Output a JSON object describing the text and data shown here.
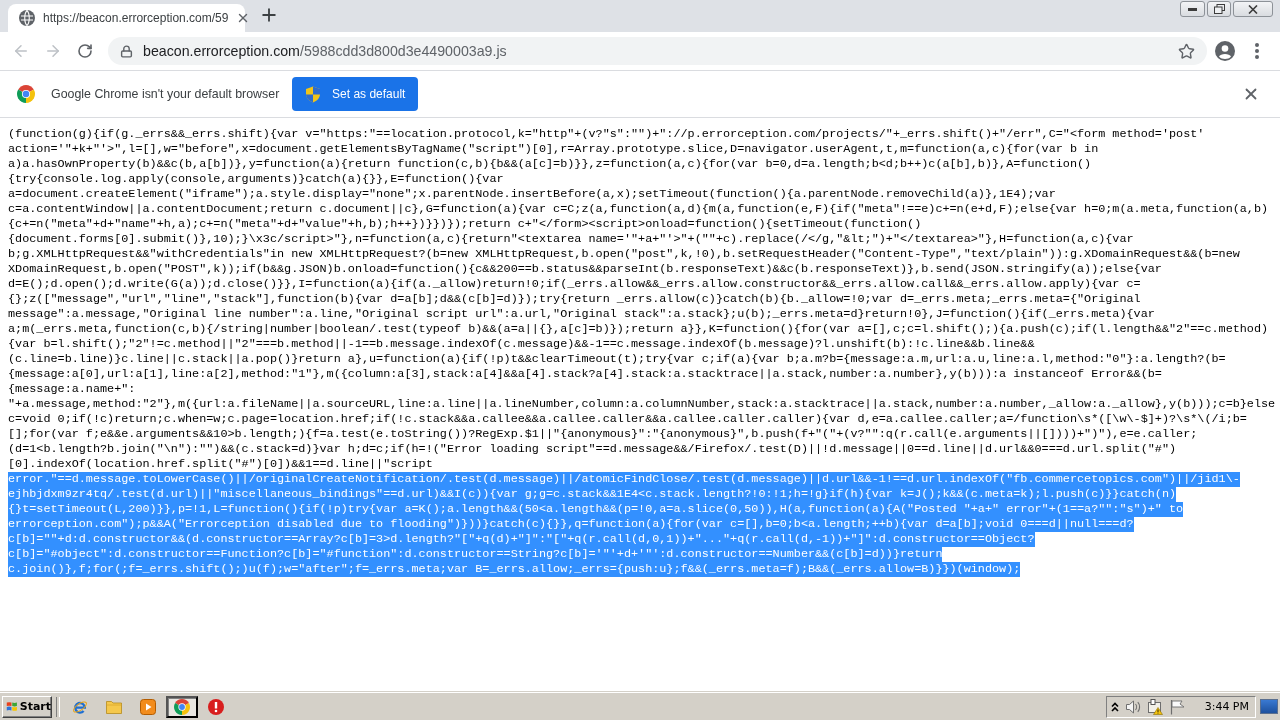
{
  "browser": {
    "tabs": [
      {
        "title": "https://beacon.errorception.com/59",
        "selected": true
      }
    ],
    "nav_buttons": [
      {
        "kind": "back",
        "disabled": true
      },
      {
        "kind": "forward",
        "disabled": true
      },
      {
        "kind": "reload",
        "disabled": false
      }
    ],
    "address_bar": {
      "domain": "beacon.errorception.com",
      "path": "/5988cdd3d800d3e4490003a9.js"
    }
  },
  "infobar": {
    "message": "Google Chrome isn't your default browser",
    "button": "Set as default"
  },
  "page": {
    "code_lines": [
      {
        "text": "(function(g){if(g._errs&&_errs.shift){var v=\"https:\"==location.protocol,k=\"http\"+(v?\"s\":\"\")+\"://p.errorception.com/projects/\"+_errs.shift()+\"/err\",C=\"<form method='post'",
        "selected": false
      },
      {
        "text": "action='\"+k+\"'>\",l=[],w=\"before\",x=document.getElementsByTagName(\"script\")[0],r=Array.prototype.slice,D=navigator.userAgent,t,m=function(a,c){for(var b in",
        "selected": false
      },
      {
        "text": "a)a.hasOwnProperty(b)&&c(b,a[b])},y=function(a){return function(c,b){b&&(a[c]=b)}},z=function(a,c){for(var b=0,d=a.length;b<d;b++)c(a[b],b)},A=function()",
        "selected": false
      },
      {
        "text": "{try{console.log.apply(console,arguments)}catch(a){}},E=function(){var",
        "selected": false
      },
      {
        "text": "a=document.createElement(\"iframe\");a.style.display=\"none\";x.parentNode.insertBefore(a,x);setTimeout(function(){a.parentNode.removeChild(a)},1E4);var",
        "selected": false
      },
      {
        "text": "c=a.contentWindow||a.contentDocument;return c.document||c},G=function(a){var c=C;z(a,function(a,d){m(a,function(e,F){if(\"meta\"!==e)c+=n(e+d,F);else{var h=0;m(a.meta,function(a,b)",
        "selected": false
      },
      {
        "text": "{c+=n(\"meta\"+d+\"name\"+h,a);c+=n(\"meta\"+d+\"value\"+h,b);h++})}})});return c+\"</form><script>onload=function(){setTimeout(function()",
        "selected": false
      },
      {
        "text": "{document.forms[0].submit()},10);}\\x3c/script>\"},n=function(a,c){return\"<textarea name='\"+a+\"'>\"+(\"\"+c).replace(/</g,\"&lt;\")+\"</textarea>\"},H=function(a,c){var",
        "selected": false
      },
      {
        "text": "b;g.XMLHttpRequest&&\"withCredentials\"in new XMLHttpRequest?(b=new XMLHttpRequest,b.open(\"post\",k,!0),b.setRequestHeader(\"Content-Type\",\"text/plain\")):g.XDomainRequest&&(b=new",
        "selected": false
      },
      {
        "text": "XDomainRequest,b.open(\"POST\",k));if(b&&g.JSON)b.onload=function(){c&&200==b.status&&parseInt(b.responseText)&&c(b.responseText)},b.send(JSON.stringify(a));else{var",
        "selected": false
      },
      {
        "text": "d=E();d.open();d.write(G(a));d.close()}},I=function(a){if(a._allow)return!0;if(_errs.allow&&_errs.allow.constructor&&_errs.allow.call&&_errs.allow.apply){var c=",
        "selected": false
      },
      {
        "text": "{};z([\"message\",\"url\",\"line\",\"stack\"],function(b){var d=a[b];d&&(c[b]=d)});try{return _errs.allow(c)}catch(b){b._allow=!0;var d=_errs.meta;_errs.meta={\"Original",
        "selected": false
      },
      {
        "text": "message\":a.message,\"Original line number\":a.line,\"Original script url\":a.url,\"Original stack\":a.stack};u(b);_errs.meta=d}return!0},J=function(){if(_errs.meta){var",
        "selected": false
      },
      {
        "text": "a;m(_errs.meta,function(c,b){/string|number|boolean/.test(typeof b)&&(a=a||{},a[c]=b)});return a}},K=function(){for(var a=[],c;c=l.shift();){a.push(c);if(l.length&&\"2\"==c.method)",
        "selected": false
      },
      {
        "text": "{var b=l.shift();\"2\"!=c.method||\"2\"===b.method||-1==b.message.indexOf(c.message)&&-1==c.message.indexOf(b.message)?l.unshift(b):!c.line&&b.line&&",
        "selected": false
      },
      {
        "text": "(c.line=b.line)}c.line||c.stack||a.pop()}return a},u=function(a){if(!p)t&&clearTimeout(t);try{var c;if(a){var b;a.m?b={message:a.m,url:a.u,line:a.l,method:\"0\"}:a.length?(b=",
        "selected": false
      },
      {
        "text": "{message:a[0],url:a[1],line:a[2],method:\"1\"},m({column:a[3],stack:a[4]&&a[4].stack?a[4].stack:a.stacktrace||a.stack,number:a.number},y(b))):a instanceof Error&&(b=",
        "selected": false
      },
      {
        "text": "{message:a.name+\":",
        "selected": false
      },
      {
        "text": "\"+a.message,method:\"2\"},m({url:a.fileName||a.sourceURL,line:a.line||a.lineNumber,column:a.columnNumber,stack:a.stacktrace||a.stack,number:a.number,_allow:a._allow},y(b)));c=b}else",
        "selected": false
      },
      {
        "text": "c=void 0;if(!c)return;c.when=w;c.page=location.href;if(!c.stack&&a.callee&&a.callee.caller&&a.callee.caller.caller){var d,e=a.callee.caller;a=/function\\s*([\\w\\-$]+)?\\s*\\(/i;b=",
        "selected": false
      },
      {
        "text": "[];for(var f;e&&e.arguments&&10>b.length;){f=a.test(e.toString())?RegExp.$1||\"{anonymous}\":\"{anonymous}\",b.push(f+\"(\"+(v?\"\":q(r.call(e.arguments||[])))+\")\"),e=e.caller;",
        "selected": false
      },
      {
        "text": "(d=1<b.length?b.join(\"\\n\"):\"\")&&(c.stack=d)}var h;d=c;if(h=!(\"Error loading script\"==d.message&&/Firefox/.test(D)||!d.message||0==d.line||d.url&&0===d.url.split(\"#\")",
        "selected": false
      },
      {
        "text": "[0].indexOf(location.href.split(\"#\")[0])&&1==d.line||\"script",
        "selected": false
      },
      {
        "text": "error.\"==d.message.toLowerCase()||/originalCreateNotification/.test(d.message)||/atomicFindClose/.test(d.message)||d.url&&-1!==d.url.indexOf(\"fb.commercetopics.com\")||/jid1\\-",
        "selected": true
      },
      {
        "text": "ejhbjdxm9zr4tq/.test(d.url)||\"miscellaneous_bindings\"==d.url)&&I(c)){var g;g=c.stack&&1E4<c.stack.length?!0:!1;h=!g}if(h){var k=J();k&&(c.meta=k);l.push(c)}}catch(n)",
        "selected": true
      },
      {
        "text": "{}t=setTimeout(L,200)}},p=!1,L=function(){if(!p)try{var a=K();a.length&&(50<a.length&&(p=!0,a=a.slice(0,50)),H(a,function(a){A(\"Posted \"+a+\" error\"+(1==a?\"\":\"s\")+\" to",
        "selected": true
      },
      {
        "text": "errorception.com\");p&&A(\"Errorception disabled due to flooding\")}))}catch(c){}},q=function(a){for(var c=[],b=0;b<a.length;++b){var d=a[b];void 0===d||null===d?",
        "selected": true
      },
      {
        "text": "c[b]=\"\"+d:d.constructor&&(d.constructor==Array?c[b]=3>d.length?\"[\"+q(d)+\"]\":\"[\"+q(r.call(d,0,1))+\"...\"+q(r.call(d,-1))+\"]\":d.constructor==Object?",
        "selected": true
      },
      {
        "text": "c[b]=\"#object\":d.constructor==Function?c[b]=\"#function\":d.constructor==String?c[b]='\"'+d+'\"':d.constructor==Number&&(c[b]=d))}return",
        "selected": true
      },
      {
        "text": "c.join()},f;for(;f=_errs.shift();)u(f);w=\"after\";f=_errs.meta;var B=_errs.allow;_errs={push:u};f&&(_errs.meta=f);B&&(_errs.allow=B)}})(window);",
        "selected": true
      }
    ]
  },
  "taskbar": {
    "start": "Start",
    "apps": [
      {
        "kind": "ie",
        "selected": false
      },
      {
        "kind": "folder",
        "selected": false
      },
      {
        "kind": "media",
        "selected": false
      },
      {
        "kind": "chrome",
        "selected": true
      },
      {
        "kind": "alert",
        "selected": false
      }
    ],
    "tray": [
      {
        "kind": "chevrons"
      },
      {
        "kind": "speaker"
      },
      {
        "kind": "network_warning"
      },
      {
        "kind": "flag"
      }
    ],
    "clock": "3:44 PM"
  }
}
